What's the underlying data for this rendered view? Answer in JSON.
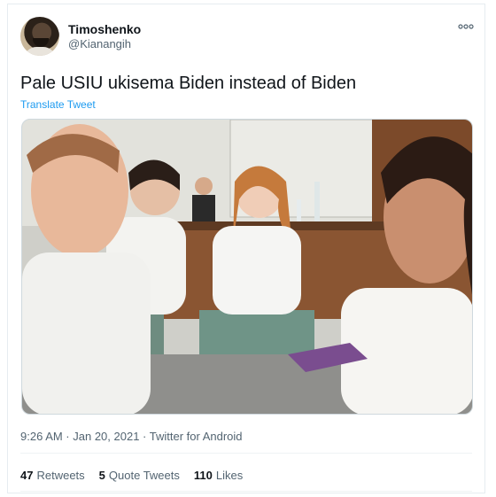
{
  "tweet": {
    "display_name": "Timoshenko",
    "handle": "@Kianangih",
    "text": "Pale USIU ukisema Biden instead of Biden",
    "translate_label": "Translate Tweet",
    "timestamp": "9:26 AM · Jan 20, 2021 · Twitter for Android",
    "stats": {
      "retweets_count": "47",
      "retweets_label": "Retweets",
      "quote_count": "5",
      "quote_label": "Quote Tweets",
      "likes_count": "110",
      "likes_label": "Likes"
    }
  },
  "icons": {
    "more": "more-icon",
    "avatar": "avatar"
  },
  "colors": {
    "link": "#1d9bf0",
    "secondary_text": "#536471",
    "divider": "#eff3f4"
  }
}
